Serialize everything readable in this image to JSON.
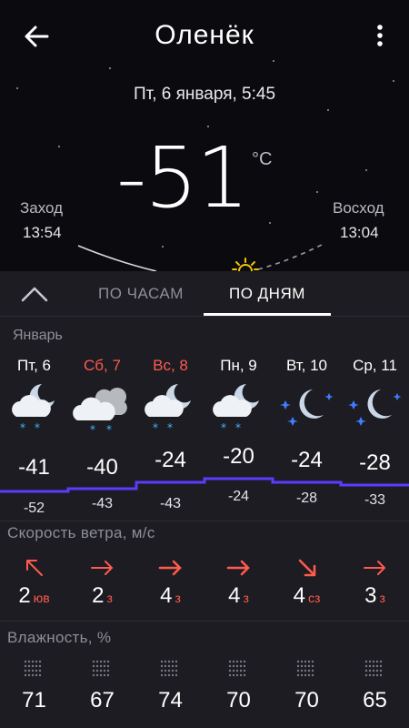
{
  "header": {
    "city": "Оленёк",
    "datetime": "Пт, 6 января, 5:45"
  },
  "current": {
    "temperature": "-51",
    "unit": "°C",
    "sunset_label": "Заход",
    "sunset_time": "13:54",
    "sunrise_label": "Восход",
    "sunrise_time": "13:04"
  },
  "tabs": {
    "hours": "ПО ЧАСАМ",
    "days": "ПО ДНЯМ",
    "active": "days"
  },
  "forecast": {
    "month": "Январь",
    "days": [
      {
        "name": "Пт, 6",
        "weekend": false,
        "icon": "cloud-moon-snow-icon",
        "high": "-41",
        "low": "-52",
        "wind_speed": "2",
        "wind_dir": "юв",
        "wind_arrow": "arrow-up-left-icon",
        "humidity": "71"
      },
      {
        "name": "Сб, 7",
        "weekend": true,
        "icon": "cloudy-snow-icon",
        "high": "-40",
        "low": "-43",
        "wind_speed": "2",
        "wind_dir": "з",
        "wind_arrow": "arrow-right-icon",
        "humidity": "67"
      },
      {
        "name": "Вс, 8",
        "weekend": true,
        "icon": "cloud-moon-snow-icon",
        "high": "-24",
        "low": "-43",
        "wind_speed": "4",
        "wind_dir": "з",
        "wind_arrow": "arrow-right-icon",
        "humidity": "74"
      },
      {
        "name": "Пн, 9",
        "weekend": false,
        "icon": "cloud-moon-snow-icon",
        "high": "-20",
        "low": "-24",
        "wind_speed": "4",
        "wind_dir": "з",
        "wind_arrow": "arrow-right-icon",
        "humidity": "70"
      },
      {
        "name": "Вт, 10",
        "weekend": false,
        "icon": "moon-stars-icon",
        "high": "-24",
        "low": "-28",
        "wind_speed": "4",
        "wind_dir": "сз",
        "wind_arrow": "arrow-down-right-icon",
        "humidity": "70"
      },
      {
        "name": "Ср, 11",
        "weekend": false,
        "icon": "moon-stars-icon",
        "high": "-28",
        "low": "-33",
        "wind_speed": "3",
        "wind_dir": "з",
        "wind_arrow": "arrow-right-icon",
        "humidity": "65"
      }
    ]
  },
  "sections": {
    "wind_title": "Скорость ветра, м/с",
    "humidity_title": "Влажность, %"
  },
  "colors": {
    "weekend": "#ff5a4e",
    "wind_arrow": "#ff5a4e",
    "temp_line": "#5b3cff",
    "snow": "#3fb6ff",
    "background": "#1c1c22",
    "sky": "#0b0b0f"
  }
}
